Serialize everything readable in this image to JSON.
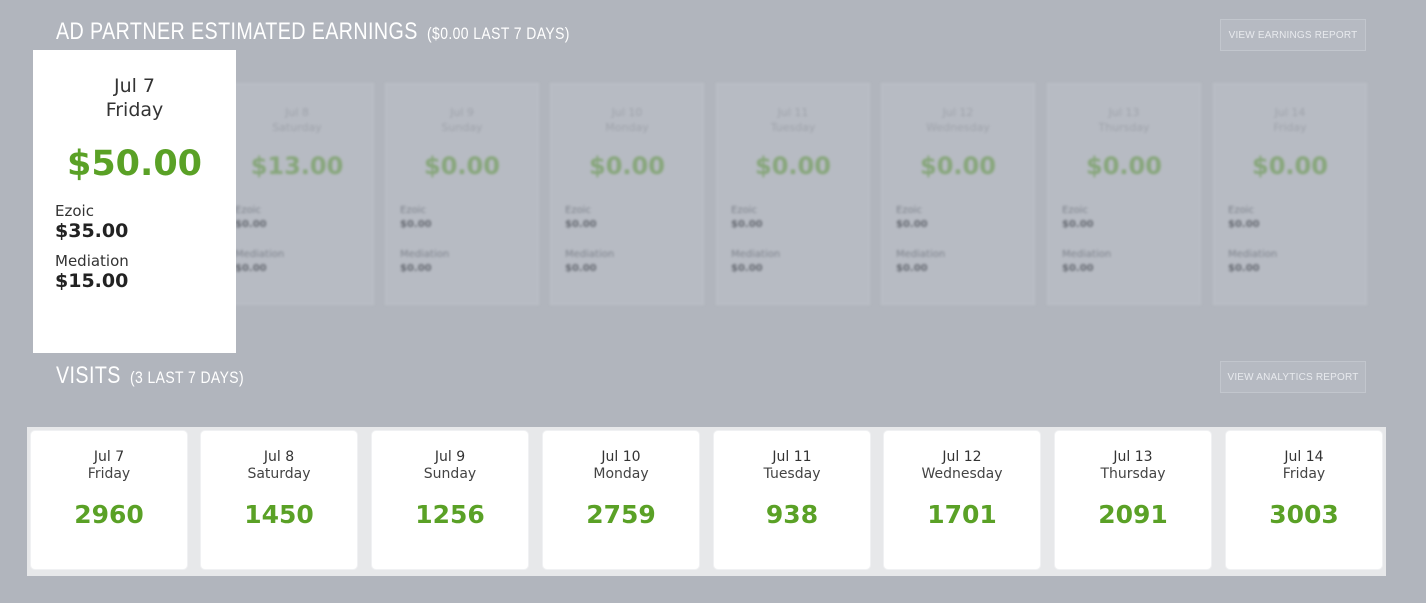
{
  "earnings": {
    "title": "AD PARTNER ESTIMATED EARNINGS",
    "subtitle": "($0.00 LAST 7 DAYS)",
    "button_label": "VIEW EARNINGS REPORT",
    "focused_card": {
      "date": "Jul 7",
      "weekday": "Friday",
      "total": "$50.00",
      "ezoic_label": "Ezoic",
      "ezoic_value": "$35.00",
      "mediation_label": "Mediation",
      "mediation_value": "$15.00"
    },
    "blurred_cards": [
      {
        "date": "Jul 8",
        "weekday": "Saturday",
        "total": "$13.00",
        "l1": "Ezoic",
        "v1": "$0.00",
        "l2": "Mediation",
        "v2": "$0.00"
      },
      {
        "date": "Jul 9",
        "weekday": "Sunday",
        "total": "$0.00",
        "l1": "Ezoic",
        "v1": "$0.00",
        "l2": "Mediation",
        "v2": "$0.00"
      },
      {
        "date": "Jul 10",
        "weekday": "Monday",
        "total": "$0.00",
        "l1": "Ezoic",
        "v1": "$0.00",
        "l2": "Mediation",
        "v2": "$0.00"
      },
      {
        "date": "Jul 11",
        "weekday": "Tuesday",
        "total": "$0.00",
        "l1": "Ezoic",
        "v1": "$0.00",
        "l2": "Mediation",
        "v2": "$0.00"
      },
      {
        "date": "Jul 12",
        "weekday": "Wednesday",
        "total": "$0.00",
        "l1": "Ezoic",
        "v1": "$0.00",
        "l2": "Mediation",
        "v2": "$0.00"
      },
      {
        "date": "Jul 13",
        "weekday": "Thursday",
        "total": "$0.00",
        "l1": "Ezoic",
        "v1": "$0.00",
        "l2": "Mediation",
        "v2": "$0.00"
      },
      {
        "date": "Jul 14",
        "weekday": "Friday",
        "total": "$0.00",
        "l1": "Ezoic",
        "v1": "$0.00",
        "l2": "Mediation",
        "v2": "$0.00"
      }
    ]
  },
  "visits": {
    "title": "VISITS",
    "subtitle": "(3 LAST 7 DAYS)",
    "button_label": "VIEW ANALYTICS REPORT",
    "cards": [
      {
        "date": "Jul 7",
        "weekday": "Friday",
        "count": "2960"
      },
      {
        "date": "Jul 8",
        "weekday": "Saturday",
        "count": "1450"
      },
      {
        "date": "Jul 9",
        "weekday": "Sunday",
        "count": "1256"
      },
      {
        "date": "Jul 10",
        "weekday": "Monday",
        "count": "2759"
      },
      {
        "date": "Jul 11",
        "weekday": "Tuesday",
        "count": "938"
      },
      {
        "date": "Jul 12",
        "weekday": "Wednesday",
        "count": "1701"
      },
      {
        "date": "Jul 13",
        "weekday": "Thursday",
        "count": "2091"
      },
      {
        "date": "Jul 14",
        "weekday": "Friday",
        "count": "3003"
      }
    ]
  },
  "colors": {
    "background": "#b1b5bd",
    "accent_green": "#5aa126",
    "card": "#ffffff"
  }
}
